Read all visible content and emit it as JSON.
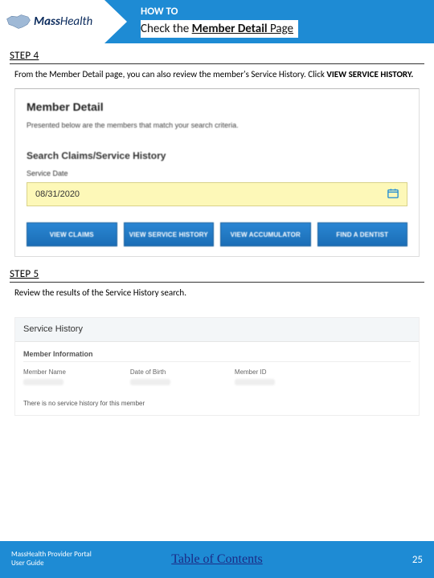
{
  "brand": {
    "mass": "Mass",
    "health": "Health"
  },
  "header": {
    "howto_label": "HOW TO",
    "title_lead": "Check the ",
    "title_bold": "Member Detail",
    "title_tail": " Page"
  },
  "step4": {
    "label": "STEP 4",
    "desc_lead": "From the Member Detail page, you can also review the member's Service History. Click ",
    "desc_bold": "VIEW SERVICE HISTORY."
  },
  "memberDetail": {
    "title": "Member Detail",
    "subtitle": "Presented below are the members that match your search criteria.",
    "search_title": "Search Claims/Service History",
    "service_date_label": "Service Date",
    "service_date_value": "08/31/2020",
    "buttons": {
      "view_claims": "VIEW CLAIMS",
      "view_service_history": "VIEW SERVICE HISTORY",
      "view_accumulator": "VIEW ACCUMULATOR",
      "find_a_dentist": "FIND A DENTIST"
    }
  },
  "step5": {
    "label": "STEP 5",
    "desc": "Review the results of the Service History search."
  },
  "serviceHistory": {
    "title": "Service History",
    "section": "Member Information",
    "fields": {
      "member_name": "Member Name",
      "date_of_birth": "Date of Birth",
      "member_id": "Member ID"
    },
    "no_history": "There is no service history for this member"
  },
  "footer": {
    "line1": "MassHealth Provider Portal",
    "line2": "User Guide",
    "toc": "Table of Contents",
    "page": "25"
  }
}
